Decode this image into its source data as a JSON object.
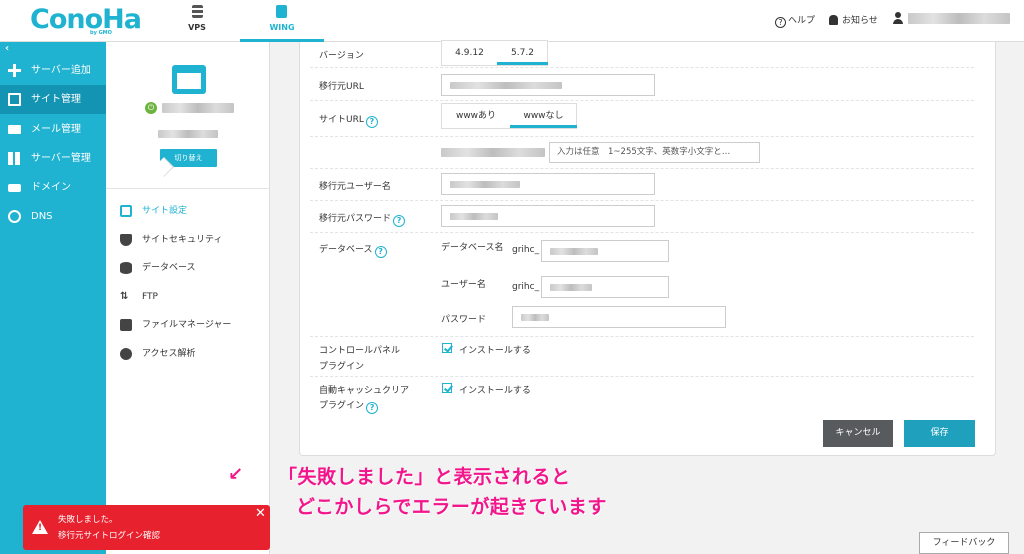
{
  "header": {
    "logo": "ConoHa",
    "logo_sub": "by GMO",
    "tabs": [
      {
        "label": "VPS"
      },
      {
        "label": "WING"
      }
    ],
    "help": "ヘルプ",
    "notices": "お知らせ"
  },
  "sidebar": {
    "collapse": "‹",
    "items": [
      {
        "label": "サーバー追加",
        "icon": "plus-icon"
      },
      {
        "label": "サイト管理",
        "icon": "site-icon"
      },
      {
        "label": "メール管理",
        "icon": "mail-icon"
      },
      {
        "label": "サーバー管理",
        "icon": "server-icon"
      },
      {
        "label": "ドメイン",
        "icon": "domain-icon"
      },
      {
        "label": "DNS",
        "icon": "globe-icon"
      }
    ]
  },
  "subpanel": {
    "switch_button": "切り替え",
    "menu": [
      {
        "label": "サイト設定"
      },
      {
        "label": "サイトセキュリティ"
      },
      {
        "label": "データベース"
      },
      {
        "label": "FTP"
      },
      {
        "label": "ファイルマネージャー"
      },
      {
        "label": "アクセス解析"
      }
    ]
  },
  "form": {
    "version_label": "バージョン",
    "versions": [
      "4.9.12",
      "5.7.2"
    ],
    "selected_version": "5.7.2",
    "source_url_label": "移行元URL",
    "site_url_label": "サイトURL",
    "www_options": [
      "wwwあり",
      "wwwなし"
    ],
    "selected_www": "wwwなし",
    "path_placeholder": "入力は任意　1~255文字、英数字小文字と…",
    "source_user_label": "移行元ユーザー名",
    "source_password_label": "移行元パスワード",
    "database_label": "データベース",
    "db_name_label": "データベース名",
    "db_prefix": "grihc_",
    "db_user_label": "ユーザー名",
    "db_user_prefix": "grihc_",
    "db_password_label": "パスワード",
    "control_panel_label_1": "コントロールパネル",
    "control_panel_label_2": "プラグイン",
    "control_panel_checkbox": "インストールする",
    "cache_label_1": "自動キャッシュクリア",
    "cache_label_2": "プラグイン",
    "cache_checkbox": "インストールする",
    "cancel": "キャンセル",
    "save": "保存"
  },
  "annotation": {
    "line1": "「失敗しました」と表示されると",
    "line2": "どこかしらでエラーが起きています",
    "arrow": "↙"
  },
  "toast": {
    "line1": "失敗しました。",
    "line2": "移行元サイトログイン確認",
    "close": "✕"
  },
  "feedback": "フィードバック"
}
